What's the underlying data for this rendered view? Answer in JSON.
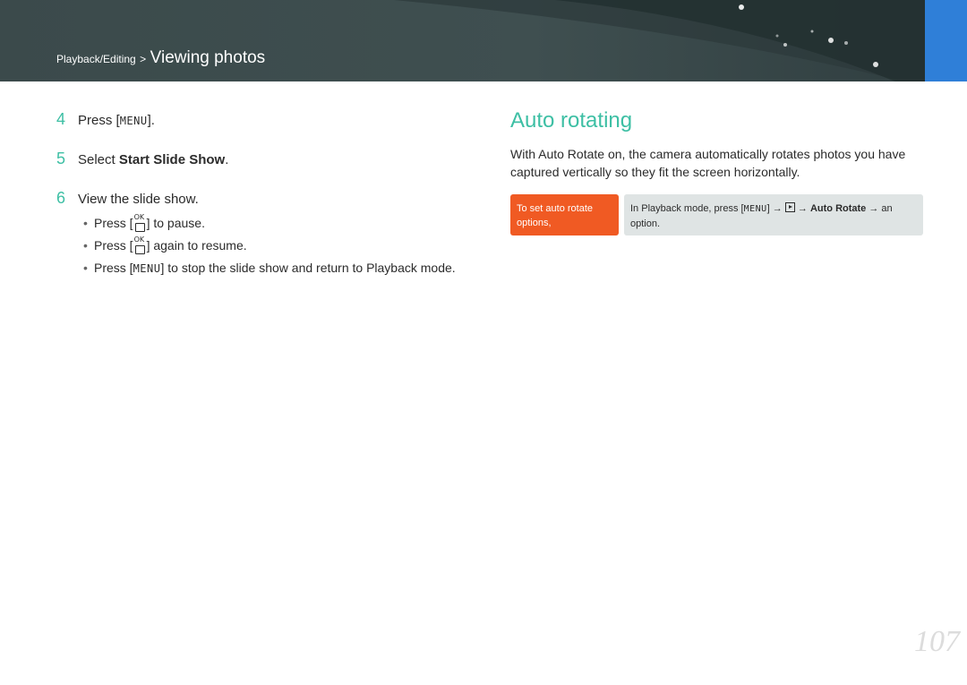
{
  "header": {
    "breadcrumb_section": "Playback/Editing",
    "breadcrumb_sep": ">",
    "breadcrumb_title": "Viewing photos",
    "accent_color": "#2f7fd8"
  },
  "steps": [
    {
      "num": "4",
      "pre": "Press [",
      "key": "MENU",
      "post": "]."
    },
    {
      "num": "5",
      "pre": "Select ",
      "bold": "Start Slide Show",
      "post": "."
    },
    {
      "num": "6",
      "text": "View the slide show."
    }
  ],
  "bullets": [
    {
      "pre": "Press [",
      "icon": "ok-button-icon",
      "post": "] to pause."
    },
    {
      "pre": "Press [",
      "icon": "ok-button-icon",
      "post": "] again to resume."
    },
    {
      "pre": "Press [",
      "key": "MENU",
      "post": "] to stop the slide show and return to Playback mode."
    }
  ],
  "icons": {
    "ok_top": "OK"
  },
  "auto_rotating": {
    "title": "Auto rotating",
    "intro": "With Auto Rotate on, the camera automatically rotates photos you have captured vertically so they fit the screen horizontally.",
    "tip_label": "To set auto rotate options,",
    "tip_pre": "In Playback mode, press [",
    "tip_key": "MENU",
    "tip_mid": "] →",
    "tip_arrow": "→",
    "tip_bold": "Auto Rotate",
    "tip_post": "→ an option."
  },
  "page_number": "107",
  "colors": {
    "teal": "#3dbfa4",
    "orange": "#f05a23",
    "header": "#3f4f50"
  }
}
